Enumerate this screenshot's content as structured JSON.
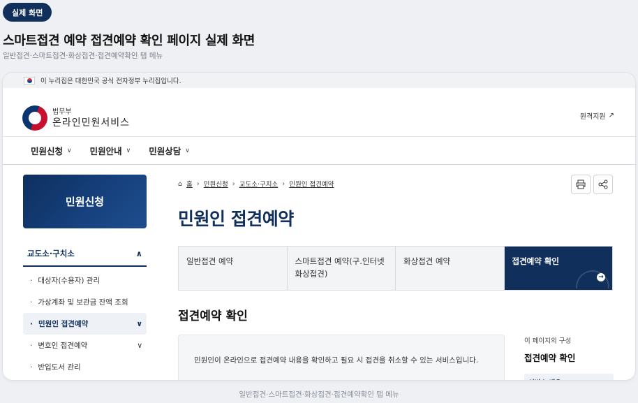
{
  "badge": "실제 화면",
  "heading": "스마트접견 예약 접견예약 확인 페이지 실제 화면",
  "subheading": "일반접견·스마트접견·화상접견·접견예약확인 탭 메뉴",
  "footer_caption": "일반접견·스마트접견·화상접견·접견예약확인 탭 메뉴",
  "gov_bar": {
    "text": "이 누리집은 대한민국 공식 전자정부 누리집입니다."
  },
  "logo": {
    "small": "법무부",
    "big": "온라인민원서비스"
  },
  "remote_support": "원격지원",
  "gnb": [
    {
      "label": "민원신청"
    },
    {
      "label": "민원안내"
    },
    {
      "label": "민원상담"
    }
  ],
  "sidebar": {
    "title": "민원신청",
    "group": "교도소·구치소",
    "items": [
      {
        "label": "대상자(수용자) 관리"
      },
      {
        "label": "가상계좌 및 보관금 잔액 조회"
      },
      {
        "label": "민원인 접견예약"
      },
      {
        "label": "변호인 접견예약"
      },
      {
        "label": "반입도서 관리"
      }
    ]
  },
  "breadcrumb": [
    "홈",
    "민원신청",
    "교도소·구치소",
    "민원인 접견예약"
  ],
  "main_title": "민원인 접견예약",
  "tabs": [
    {
      "label": "일반접견 예약"
    },
    {
      "label": "스마트접견 예약(구.인터넷화상접견)"
    },
    {
      "label": "화상접견 예약"
    },
    {
      "label": "접견예약 확인"
    }
  ],
  "section_title": "접견예약 확인",
  "info_text": "민원인이 온라인으로 접견예약 내용을 확인하고 필요 시 접견을 취소할 수 있는 서비스입니다.",
  "toc": {
    "label": "이 페이지의 구성",
    "title": "접견예약 확인",
    "chip": "서비스 개요"
  },
  "colors": {
    "navy": "#102f5b",
    "background": "#eef0f4"
  }
}
